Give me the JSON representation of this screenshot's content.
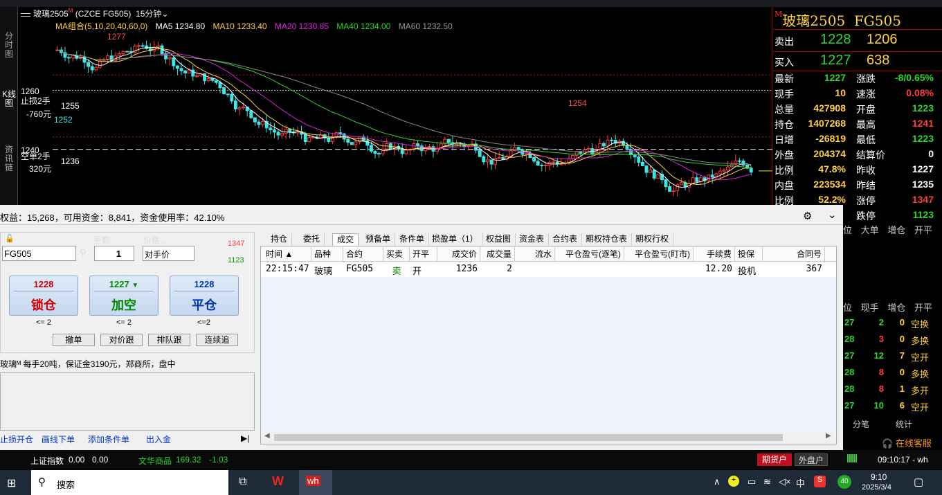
{
  "app": {
    "instrument": "玻璃2505",
    "code": "FG505",
    "exchange_code": "(CZCE FG505)",
    "period": "15分钟",
    "title_cn": "玻璃2505",
    "title_code": "FG505"
  },
  "sidetabs": [
    "分时图",
    "K线图",
    "资讯链"
  ],
  "ma_legend": {
    "group": "MA组合(5,10,20,40,60,0)",
    "ma5": "MA5 1234.80",
    "ma10": "MA10 1233.40",
    "ma20": "MA20 1230.85",
    "ma40": "MA40 1234.00",
    "ma60": "MA60 1232.50"
  },
  "chart_data": {
    "type": "candlestick",
    "title": "",
    "yticks": [
      "1260",
      "1240"
    ],
    "annotations": [
      "1277",
      "1254",
      "1255",
      "1252",
      "止损2手",
      "-760元",
      "空单2手",
      "320元",
      "1236"
    ],
    "ylim": [
      1218,
      1282
    ]
  },
  "quote": {
    "sell_label": "卖出",
    "sell_price": "1228",
    "sell_qty": "1206",
    "buy_label": "买入",
    "buy_price": "1227",
    "buy_qty": "638",
    "rows": [
      {
        "l1": "最新",
        "v1": "1227",
        "c1": "g",
        "l2": "涨跌",
        "v2": "-8/0.65%",
        "c2": "g"
      },
      {
        "l1": "现手",
        "v1": "10",
        "c1": "y",
        "l2": "速涨",
        "v2": "0.08%",
        "c2": "r"
      },
      {
        "l1": "总量",
        "v1": "427908",
        "c1": "y",
        "l2": "开盘",
        "v2": "1223",
        "c2": "g"
      },
      {
        "l1": "持仓",
        "v1": "1407268",
        "c1": "y",
        "l2": "最高",
        "v2": "1241",
        "c2": "r"
      },
      {
        "l1": "日增",
        "v1": "-26819",
        "c1": "y",
        "l2": "最低",
        "v2": "1223",
        "c2": "g"
      },
      {
        "l1": "外盘",
        "v1": "204374",
        "c1": "y",
        "l2": "结算价",
        "v2": "0",
        "c2": "w"
      },
      {
        "l1": "比例",
        "v1": "47.8%",
        "c1": "y",
        "l2": "昨收",
        "v2": "1227",
        "c2": "w"
      },
      {
        "l1": "内盘",
        "v1": "223534",
        "c1": "y",
        "l2": "昨结",
        "v2": "1235",
        "c2": "w"
      },
      {
        "l1": "比例",
        "v1": "52.2%",
        "c1": "y",
        "l2": "涨停",
        "v2": "1347",
        "c2": "r"
      },
      {
        "l1": "",
        "v1": "",
        "c1": "y",
        "l2": "跌停",
        "v2": "1123",
        "c2": "g"
      }
    ]
  },
  "rightlist": {
    "h1": [
      "位",
      "大单",
      "增仓",
      "开平"
    ],
    "h2": [
      "位",
      "现手",
      "增仓",
      "开平"
    ],
    "ticks": [
      {
        "p": "27",
        "q": "2",
        "i": "0",
        "t": "空换",
        "pc": "g",
        "qc": "g",
        "tc": "y"
      },
      {
        "p": "28",
        "q": "3",
        "i": "0",
        "t": "多换",
        "pc": "g",
        "qc": "r",
        "tc": "y"
      },
      {
        "p": "27",
        "q": "12",
        "i": "7",
        "t": "空开",
        "pc": "g",
        "qc": "g",
        "tc": "y"
      },
      {
        "p": "28",
        "q": "8",
        "i": "0",
        "t": "多换",
        "pc": "g",
        "qc": "r",
        "tc": "y"
      },
      {
        "p": "28",
        "q": "8",
        "i": "1",
        "t": "多开",
        "pc": "g",
        "qc": "r",
        "tc": "y"
      },
      {
        "p": "27",
        "q": "10",
        "i": "6",
        "t": "空开",
        "pc": "g",
        "qc": "g",
        "tc": "y"
      }
    ],
    "tabs": [
      "分笔",
      "统计"
    ],
    "service": "在线客服"
  },
  "account": "权益：15,268，可用资金：8,841，资金使用率：42.10%",
  "order": {
    "lots_label": "手数",
    "price_label": "价格 ...",
    "contract": "FG505",
    "lots": "1",
    "price_mode": "对手价",
    "upper": "1347",
    "lower": "1123",
    "buttons": [
      {
        "price": "1228",
        "label": "锁仓",
        "limit": "<= 2"
      },
      {
        "price": "1227",
        "label": "加空",
        "limit": "<= 2"
      },
      {
        "price": "1228",
        "label": "平仓",
        "limit": "<=2"
      }
    ],
    "small": [
      "撤单",
      "对价跟",
      "排队跟",
      "连续追"
    ],
    "info": "玻璃ᴹ 每手20吨，保证金3190元，郑商所，盘中",
    "links": [
      "止损开仓",
      "画线下单",
      "添加条件单",
      "出入金"
    ]
  },
  "tabs": [
    "持仓",
    "委托",
    "成交",
    "预备单",
    "条件单",
    "损盈单（1）",
    "权益图",
    "资金表",
    "合约表",
    "期权持仓表",
    "期权行权"
  ],
  "table": {
    "headers": [
      "时间 ▲",
      "品种",
      "合约",
      "买卖",
      "开平",
      "成交价",
      "成交量",
      "流水",
      "平仓盈亏(逐笔)",
      "平仓盈亏(盯市)",
      "手续费",
      "投保",
      "合同号"
    ],
    "row": [
      "22:15:47",
      "玻璃",
      "FG505",
      "卖",
      "开",
      "1236",
      "2",
      "",
      "",
      "",
      "12.20",
      "投机",
      "367"
    ]
  },
  "status": {
    "idx1": "上证指数",
    "v1": "0.00",
    "v2": "0.00",
    "idx2": "文华商品",
    "v3": "169.32",
    "v4": "-1.03",
    "btn1": "期货户",
    "btn2": "外盘户",
    "time": "09:10:17 - wh"
  },
  "taskbar": {
    "search": "搜索",
    "time": "9:10",
    "date": "2025/3/4",
    "lang": "中",
    "badge": "40"
  }
}
